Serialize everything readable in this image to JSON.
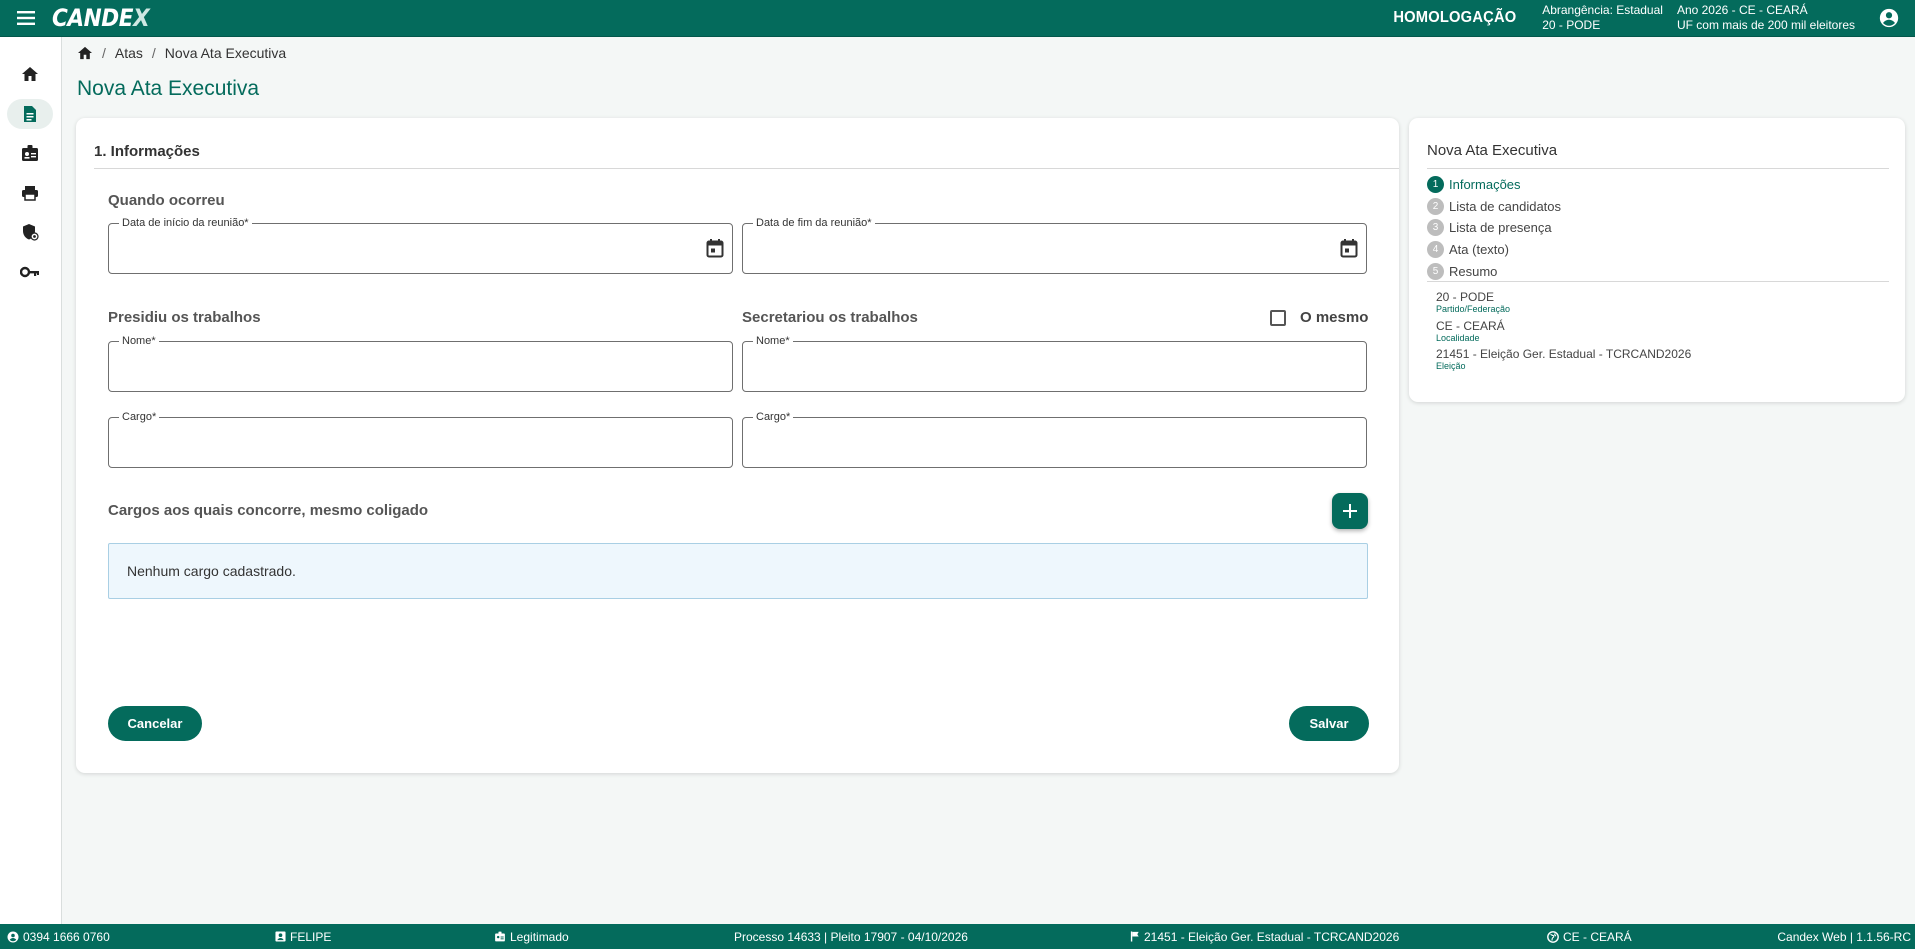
{
  "header": {
    "logo_text": "CANDE",
    "logo_x": "X",
    "environment": "HOMOLOGAÇÃO",
    "scope_line1": "Abrangência: Estadual",
    "scope_line2": "20 - PODE",
    "year_line1": "Ano 2026 - CE - CEARÁ",
    "year_line2": "UF com mais de 200 mil eleitores"
  },
  "sidebar": {
    "items": [
      {
        "icon": "home-icon"
      },
      {
        "icon": "document-icon"
      },
      {
        "icon": "id-badge-icon"
      },
      {
        "icon": "printer-icon"
      },
      {
        "icon": "shield-icon"
      },
      {
        "icon": "key-icon"
      }
    ]
  },
  "breadcrumb": {
    "items": [
      "Atas",
      "Nova Ata Executiva"
    ]
  },
  "page": {
    "title": "Nova Ata Executiva"
  },
  "form": {
    "section_title": "1. Informações",
    "when_label": "Quando ocorreu",
    "start_date_label": "Data de início da reunião*",
    "end_date_label": "Data de fim da reunião*",
    "presided_label": "Presidiu os trabalhos",
    "secretary_label": "Secretariou os trabalhos",
    "same_label": "O mesmo",
    "name_label_1": "Nome*",
    "name_label_2": "Nome*",
    "role_label_1": "Cargo*",
    "role_label_2": "Cargo*",
    "positions_label": "Cargos aos quais concorre, mesmo coligado",
    "empty_message": "Nenhum cargo cadastrado.",
    "cancel_label": "Cancelar",
    "save_label": "Salvar"
  },
  "side_panel": {
    "title": "Nova Ata Executiva",
    "steps": [
      {
        "num": "1",
        "label": "Informações",
        "active": true
      },
      {
        "num": "2",
        "label": "Lista de candidatos",
        "active": false
      },
      {
        "num": "3",
        "label": "Lista de presença",
        "active": false
      },
      {
        "num": "4",
        "label": "Ata (texto)",
        "active": false
      },
      {
        "num": "5",
        "label": "Resumo",
        "active": false
      }
    ],
    "meta": [
      {
        "value": "20 - PODE",
        "label": "Partido/Federação"
      },
      {
        "value": "CE - CEARÁ",
        "label": "Localidade"
      },
      {
        "value": "21451 - Eleição Ger. Estadual - TCRCAND2026",
        "label": "Eleição"
      }
    ]
  },
  "footer": {
    "phone": "0394 1666 0760",
    "user": "FELIPE",
    "status": "Legitimado",
    "process": "Processo 14633 | Pleito 17907 - 04/10/2026",
    "election": "21451 - Eleição Ger. Estadual - TCRCAND2026",
    "location": "CE - CEARÁ",
    "version": "Candex Web | 1.1.56-RC"
  },
  "colors": {
    "primary": "#046b5c",
    "info_bg": "#eef7fd",
    "info_border": "#a9cfe4"
  }
}
